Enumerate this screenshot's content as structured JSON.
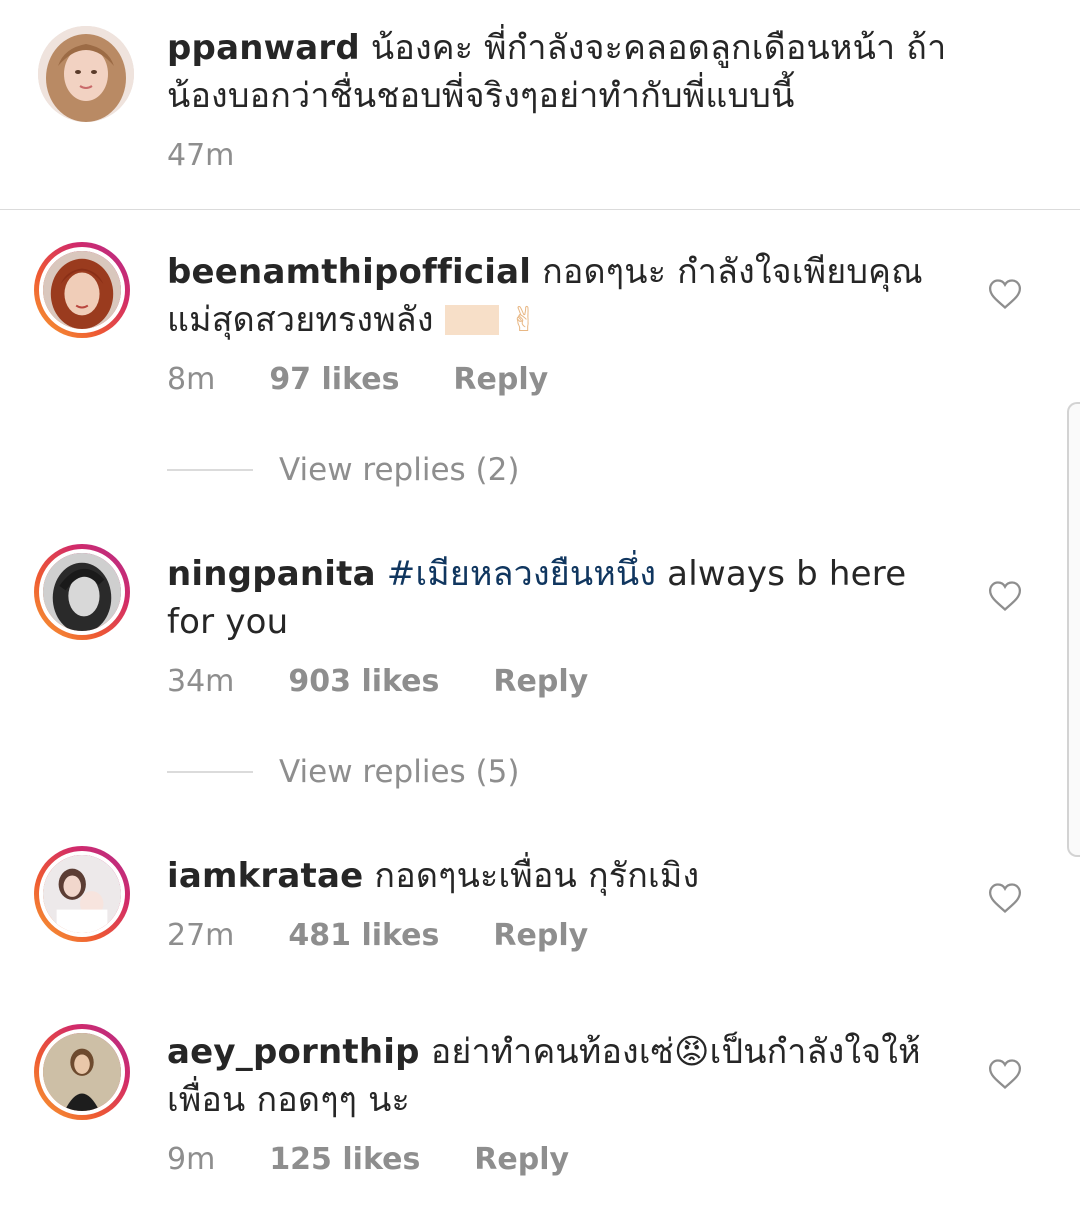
{
  "caption": {
    "username": "ppanward",
    "text": "น้องคะ พี่กำลังจะคลอดลูกเดือนหน้า  ถ้าน้องบอกว่าชื่นชอบพี่จริงๆอย่าทำกับพี่แบบนี้",
    "time": "47m"
  },
  "comments": [
    {
      "username": "beenamthipofficial",
      "text": "กอดๆนะ กำลังใจเพียบคุณแม่สุดสวยทรงพลัง ",
      "emoji": "✌",
      "time": "8m",
      "likes": "97 likes",
      "reply": "Reply",
      "view_replies": "View replies (2)"
    },
    {
      "username": "ningpanita",
      "hashtag": "#เมียหลวงยืนหนึ่ง",
      "text": " always b here for you",
      "time": "34m",
      "likes": "903 likes",
      "reply": "Reply",
      "view_replies": "View replies (5)"
    },
    {
      "username": "iamkratae",
      "text": "กอดๆนะเพื่อน กุรักเมิง",
      "time": "27m",
      "likes": "481 likes",
      "reply": "Reply"
    },
    {
      "username": "aey_pornthip",
      "text_before": "อย่าทำคนท้องเซ่",
      "emoji": "😡",
      "text_after": "เป็นกำลังใจให้เพื่อน กอดๆๆ นะ",
      "time": "9m",
      "likes": "125 likes",
      "reply": "Reply"
    }
  ],
  "icons": {
    "like": "heart-outline-icon"
  },
  "colors": {
    "text": "#262626",
    "secondary": "#8e8e8e",
    "hashtag": "#10365f",
    "divider": "#dbdbdb"
  }
}
